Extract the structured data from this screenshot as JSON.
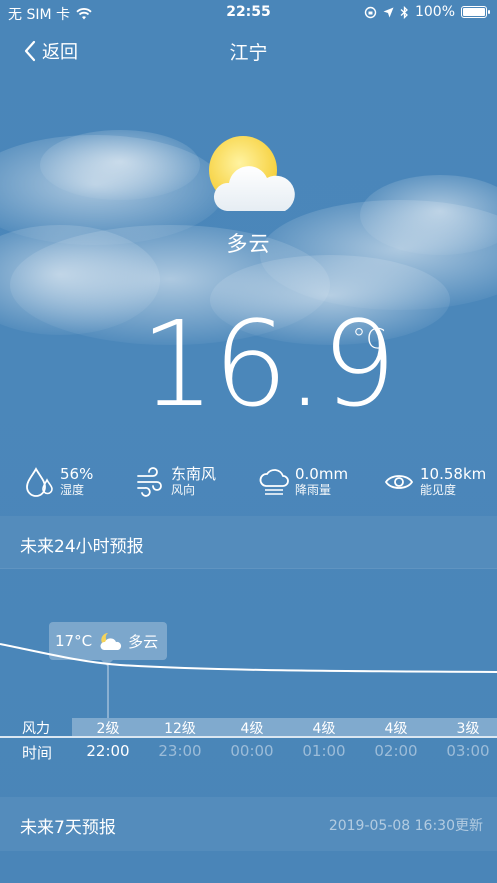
{
  "status_bar": {
    "carrier": "无 SIM 卡",
    "time": "22:55",
    "battery": "100%",
    "battery_level": 1.0
  },
  "nav": {
    "back_label": "返回",
    "title": "江宁"
  },
  "current": {
    "condition": "多云",
    "temperature": "16.9",
    "unit": "°C",
    "icon": "sun-cloud-icon"
  },
  "stats": {
    "humidity": {
      "value": "56%",
      "label": "湿度",
      "icon": "humidity-drops-icon"
    },
    "wind": {
      "value": "东南风",
      "label": "风向",
      "icon": "wind-icon"
    },
    "rain": {
      "value": "0.0mm",
      "label": "降雨量",
      "icon": "rain-cloud-icon"
    },
    "visibility": {
      "value": "10.58km",
      "label": "能见度",
      "icon": "eye-icon"
    }
  },
  "hourly": {
    "title": "未来24小时预报",
    "tooltip": {
      "temp": "17°C",
      "condition": "多云",
      "icon": "moon-cloud-icon"
    },
    "wind_label": "风力",
    "time_label": "时间",
    "wind_levels": [
      "2级",
      "12级",
      "4级",
      "4级",
      "4级",
      "3级"
    ],
    "times": [
      "22:00",
      "23:00",
      "00:00",
      "01:00",
      "02:00",
      "03:00"
    ],
    "active_index": 0
  },
  "weekly": {
    "title": "未来7天预报",
    "updated": "2019-05-08 16:30更新"
  }
}
